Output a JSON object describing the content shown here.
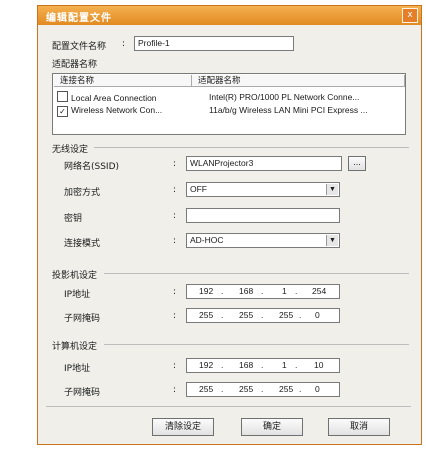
{
  "window": {
    "title": "编辑配置文件",
    "close_glyph": "x"
  },
  "profile": {
    "label": "配置文件名称",
    "colon": ":",
    "value": "Profile-1"
  },
  "adapters": {
    "group_label": "适配器名称",
    "columns": [
      "连接名称",
      "适配器名称"
    ],
    "rows": [
      {
        "checked": false,
        "connection": "Local Area Connection",
        "adapter": "Intel(R) PRO/1000 PL Network Conne..."
      },
      {
        "checked": true,
        "connection": "Wireless Network Con...",
        "adapter": "11a/b/g Wireless LAN Mini PCI Express ..."
      }
    ]
  },
  "wireless": {
    "section_label": "无线设定",
    "ssid_label": "网络名(SSID)",
    "ssid_value": "WLANProjector3",
    "browse_label": "...",
    "encryption_label": "加密方式",
    "encryption_value": "OFF",
    "key_label": "密钥",
    "key_value": "",
    "mode_label": "连接模式",
    "mode_value": "AD-HOC"
  },
  "projector": {
    "section_label": "投影机设定",
    "ip_label": "IP地址",
    "ip": [
      "192",
      "168",
      "1",
      "254"
    ],
    "mask_label": "子网掩码",
    "mask": [
      "255",
      "255",
      "255",
      "0"
    ]
  },
  "computer": {
    "section_label": "计算机设定",
    "ip_label": "IP地址",
    "ip": [
      "192",
      "168",
      "1",
      "10"
    ],
    "mask_label": "子网掩码",
    "mask": [
      "255",
      "255",
      "255",
      "0"
    ]
  },
  "buttons": {
    "clear": "清除设定",
    "ok": "确定",
    "cancel": "取消"
  },
  "misc": {
    "colon": ":",
    "dot": ".",
    "check": "✓",
    "arrow": "▼"
  }
}
